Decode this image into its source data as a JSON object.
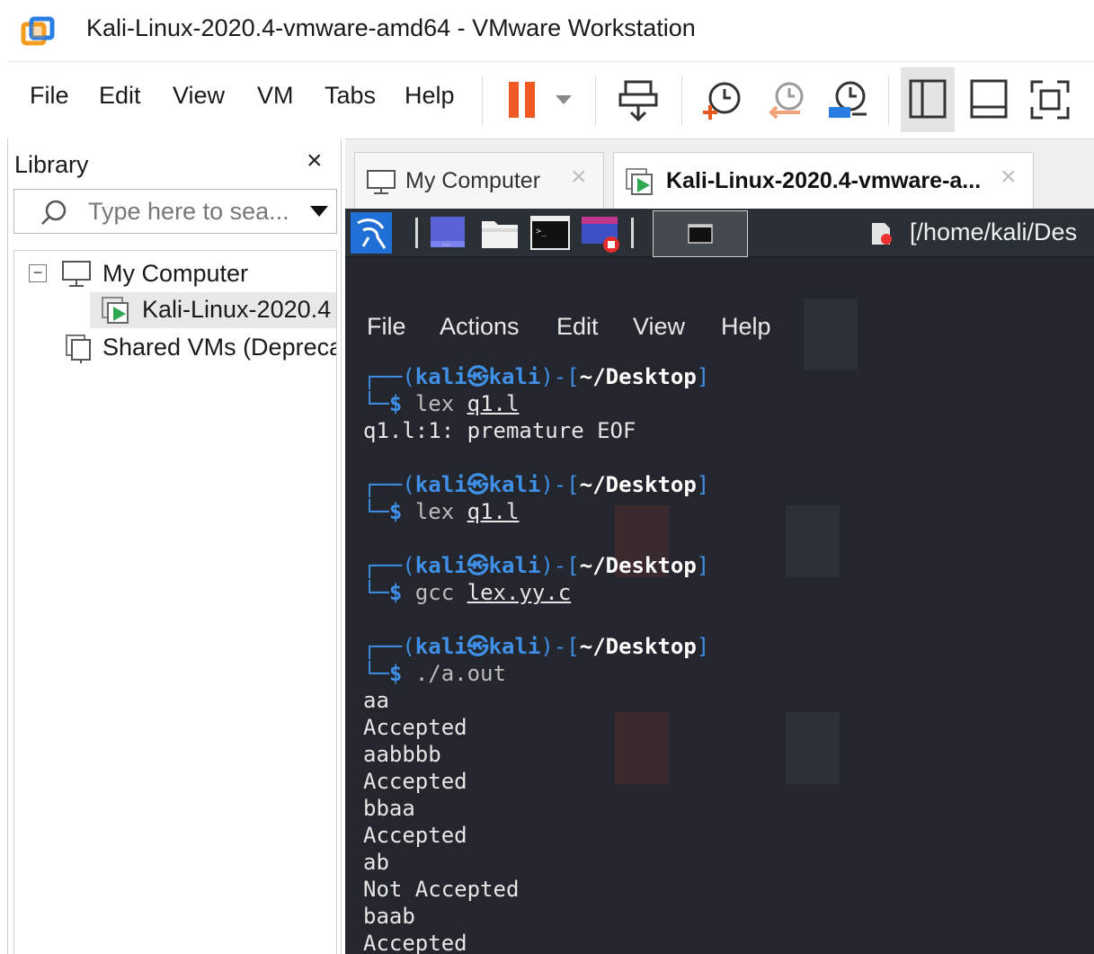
{
  "window": {
    "title": "Kali-Linux-2020.4-vmware-amd64 - VMware Workstation"
  },
  "menubar": {
    "items": [
      "File",
      "Edit",
      "View",
      "VM",
      "Tabs",
      "Help"
    ]
  },
  "toolbar": {
    "icons": [
      "pause-icon",
      "dropdown-icon",
      "send-ctrl-alt-del-icon",
      "take-snapshot-icon",
      "revert-snapshot-icon",
      "snapshot-manager-icon",
      "show-library-icon",
      "thumbnail-bar-icon",
      "full-screen-icon"
    ],
    "pause_color": "#f05a22"
  },
  "library": {
    "title": "Library",
    "close": "×",
    "search": {
      "placeholder": "Type here to sea...",
      "value": ""
    },
    "tree": [
      {
        "label": "My Computer",
        "expander": "⊟"
      },
      {
        "label": "Kali-Linux-2020.4"
      },
      {
        "label": "Shared VMs (Deprecated)"
      }
    ]
  },
  "tabs": [
    {
      "label": "My Computer",
      "close": "×"
    },
    {
      "label": "Kali-Linux-2020.4-vmware-a...",
      "close": "×"
    }
  ],
  "guest": {
    "panel_path": "[/home/kali/Des",
    "terminal_menu": [
      "File",
      "Actions",
      "Edit",
      "View",
      "Help"
    ],
    "prompt": {
      "user": "kali",
      "host": "kali",
      "at": "㉿",
      "cwd": "~/Desktop"
    },
    "blocks": [
      {
        "cmd": "lex",
        "arg": "q1.l",
        "output": [
          "q1.l:1: premature EOF"
        ]
      },
      {
        "cmd": "lex",
        "arg": "q1.l",
        "output": []
      },
      {
        "cmd": "gcc",
        "arg": "lex.yy.c",
        "output": []
      },
      {
        "cmd": "./a.out",
        "arg": "",
        "output": [
          "aa",
          "Accepted",
          "aabbbb",
          "Accepted",
          "bbaa",
          "Accepted",
          "ab",
          "Not Accepted",
          "baab",
          "Accepted"
        ]
      }
    ],
    "colors": {
      "background": "#23262c",
      "prompt": "#3f8fe6"
    }
  }
}
